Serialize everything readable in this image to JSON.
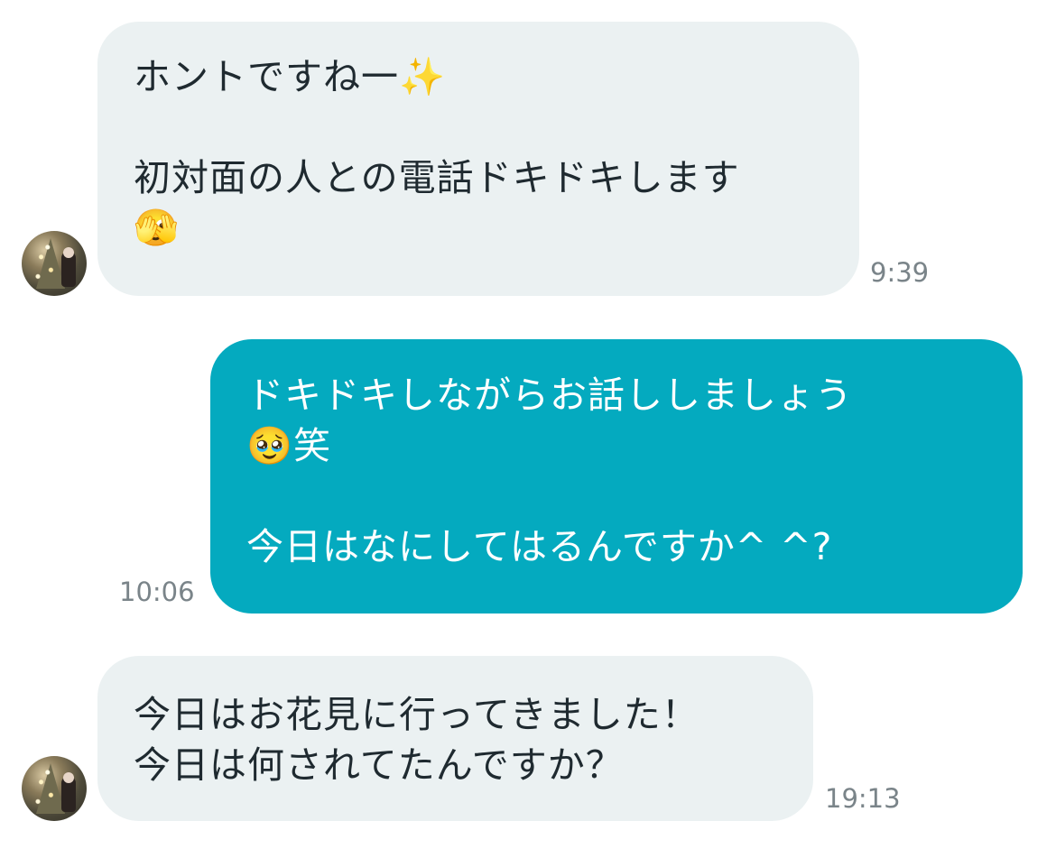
{
  "messages": [
    {
      "direction": "incoming",
      "lines": [
        "ホントですね一✨",
        "",
        "初対面の人との電話ドキドキします",
        "🫣"
      ],
      "time": "9:39"
    },
    {
      "direction": "outgoing",
      "lines": [
        "ドキドキしながらお話ししましょう",
        "🥹笑",
        "",
        "今日はなにしてはるんですか^ ^?"
      ],
      "time": "10:06"
    },
    {
      "direction": "incoming",
      "lines": [
        "今日はお花見に行ってきました！",
        "今日は何されてたんですか？"
      ],
      "time": "19:13"
    }
  ],
  "colors": {
    "incoming_bubble": "#ebf1f2",
    "outgoing_bubble": "#04aabf",
    "timestamp": "#7a8489"
  }
}
